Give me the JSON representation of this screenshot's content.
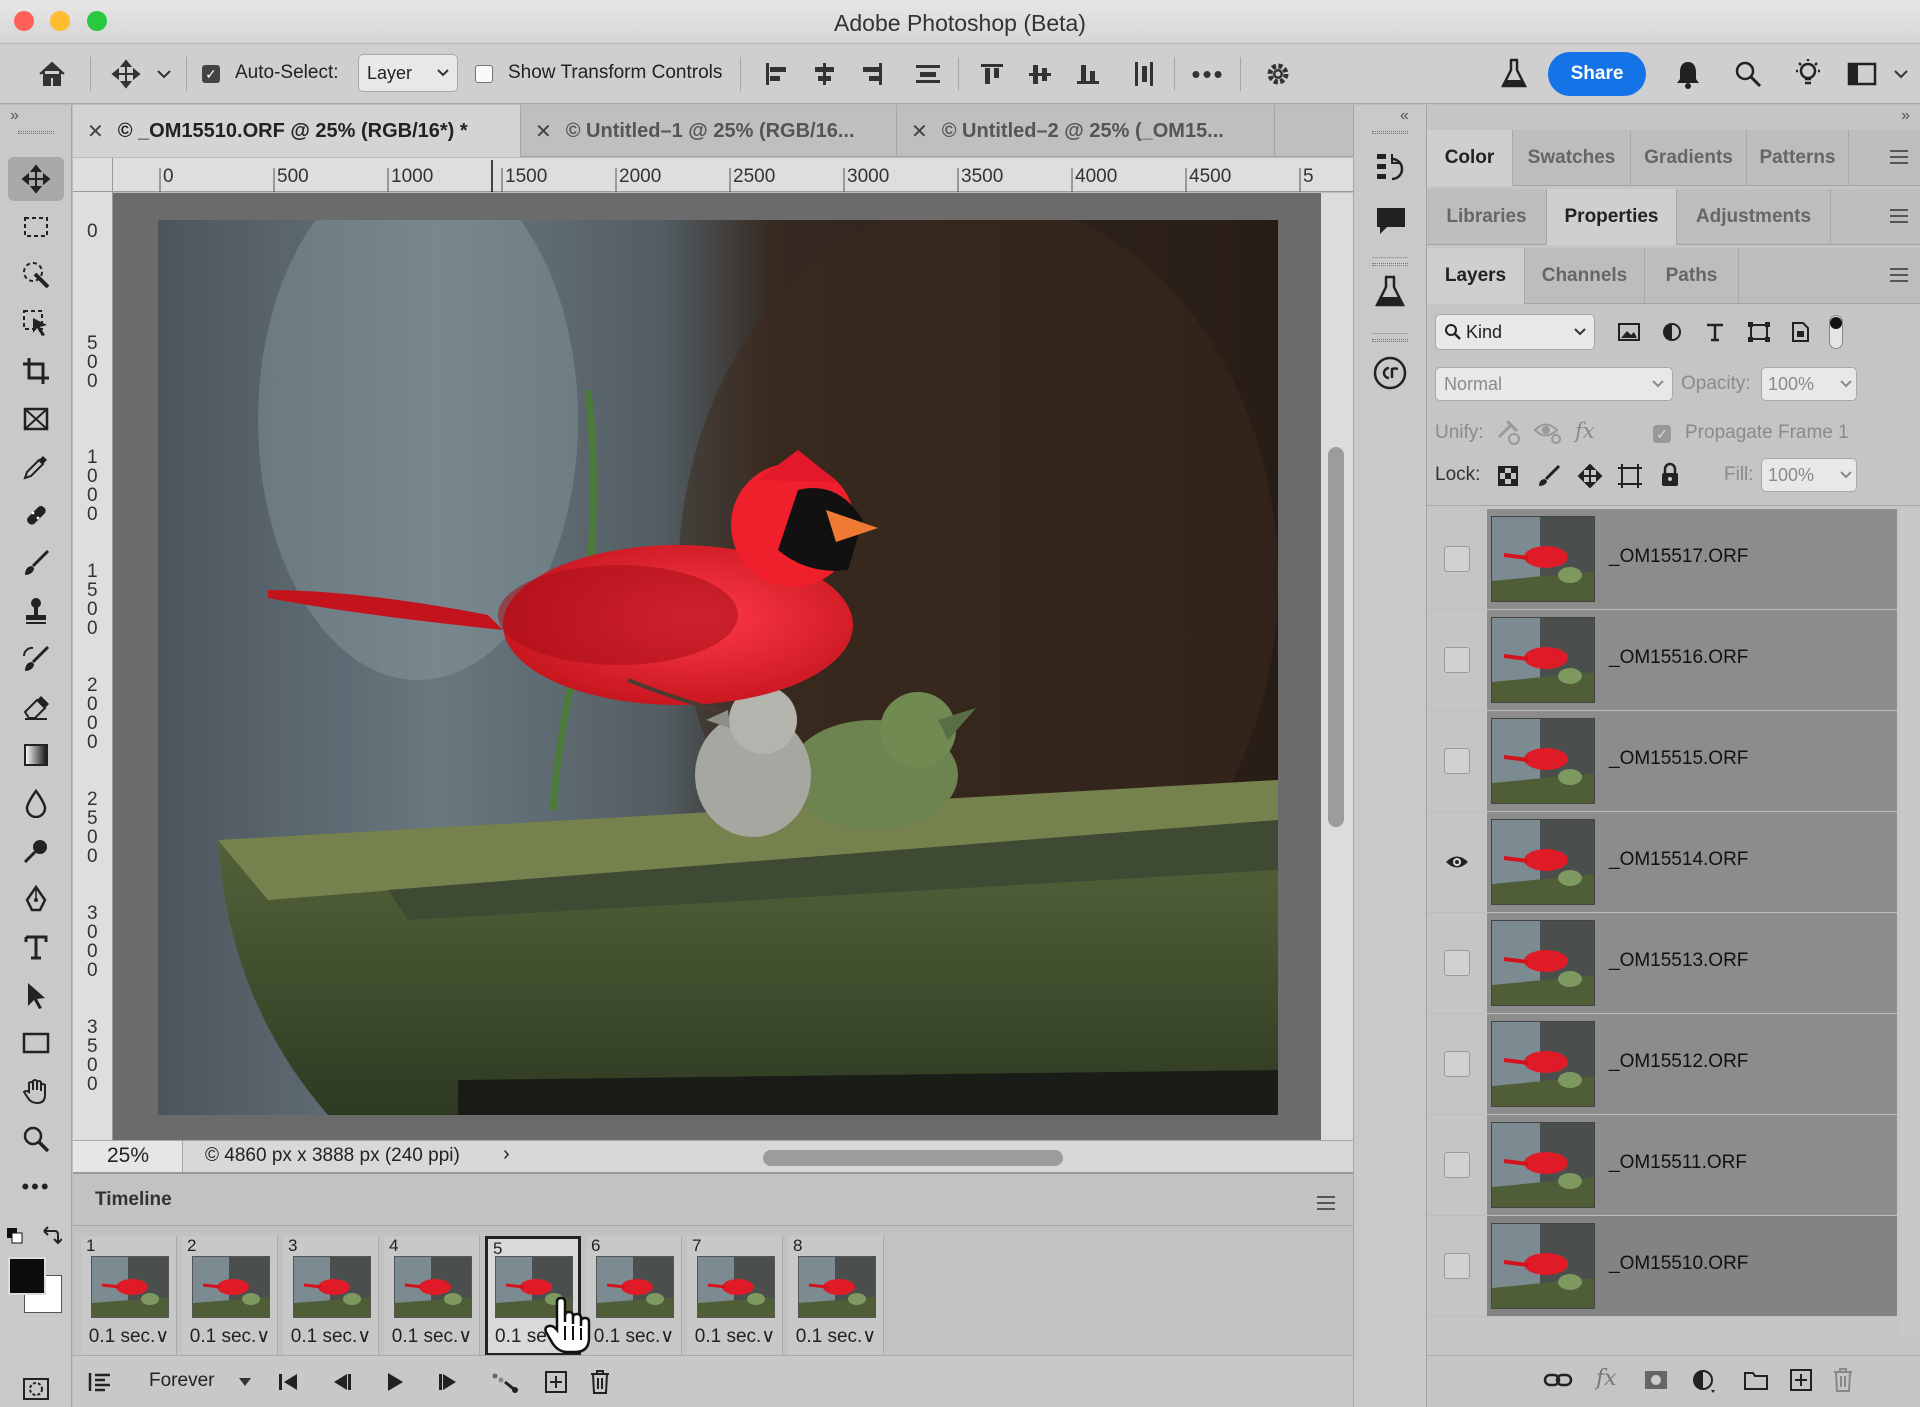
{
  "window": {
    "title": "Adobe Photoshop (Beta)"
  },
  "options_bar": {
    "auto_select_label": "Auto-Select:",
    "auto_select_value": "Layer",
    "show_transform_label": "Show Transform Controls",
    "share_label": "Share"
  },
  "tabs": [
    {
      "label": "© _OM15510.ORF @ 25% (RGB/16*) *",
      "active": true
    },
    {
      "label": "© Untitled–1 @ 25% (RGB/16...",
      "active": false
    },
    {
      "label": "© Untitled–2 @ 25% (_OM15...",
      "active": false
    }
  ],
  "ruler_h": [
    "0",
    "500",
    "1000",
    "1500",
    "2000",
    "2500",
    "3000",
    "3500",
    "4000",
    "4500",
    "5"
  ],
  "ruler_v": [
    "0",
    "500",
    "1000",
    "1500",
    "2000",
    "2500",
    "3000",
    "3500"
  ],
  "status": {
    "zoom": "25%",
    "doc_info": "© 4860 px x 3888 px (240 ppi)"
  },
  "timeline": {
    "title": "Timeline",
    "loop": "Forever",
    "frames": [
      {
        "num": "1",
        "delay": "0.1 sec.∨"
      },
      {
        "num": "2",
        "delay": "0.1 sec.∨"
      },
      {
        "num": "3",
        "delay": "0.1 sec.∨"
      },
      {
        "num": "4",
        "delay": "0.1 sec.∨"
      },
      {
        "num": "5",
        "delay": "0.1 se"
      },
      {
        "num": "6",
        "delay": "0.1 sec.∨"
      },
      {
        "num": "7",
        "delay": "0.1 sec.∨"
      },
      {
        "num": "8",
        "delay": "0.1 sec.∨"
      }
    ]
  },
  "panel_tabs_1": [
    "Color",
    "Swatches",
    "Gradients",
    "Patterns"
  ],
  "panel_tabs_2": [
    "Libraries",
    "Properties",
    "Adjustments"
  ],
  "panel_tabs_3": [
    "Layers",
    "Channels",
    "Paths"
  ],
  "layers_panel": {
    "filter_kind": "Kind",
    "blend_mode": "Normal",
    "opacity_label": "Opacity:",
    "opacity_value": "100%",
    "unify_label": "Unify:",
    "propagate_label": "Propagate Frame 1",
    "lock_label": "Lock:",
    "fill_label": "Fill:",
    "fill_value": "100%",
    "layers": [
      {
        "name": "_OM15517.ORF",
        "visible": false
      },
      {
        "name": "_OM15516.ORF",
        "visible": false
      },
      {
        "name": "_OM15515.ORF",
        "visible": false
      },
      {
        "name": "_OM15514.ORF",
        "visible": true
      },
      {
        "name": "_OM15513.ORF",
        "visible": false
      },
      {
        "name": "_OM15512.ORF",
        "visible": false
      },
      {
        "name": "_OM15511.ORF",
        "visible": false
      },
      {
        "name": "_OM15510.ORF",
        "visible": false
      }
    ]
  },
  "colors": {
    "accent": "#1473e6",
    "cardinal": "#e01b28"
  }
}
